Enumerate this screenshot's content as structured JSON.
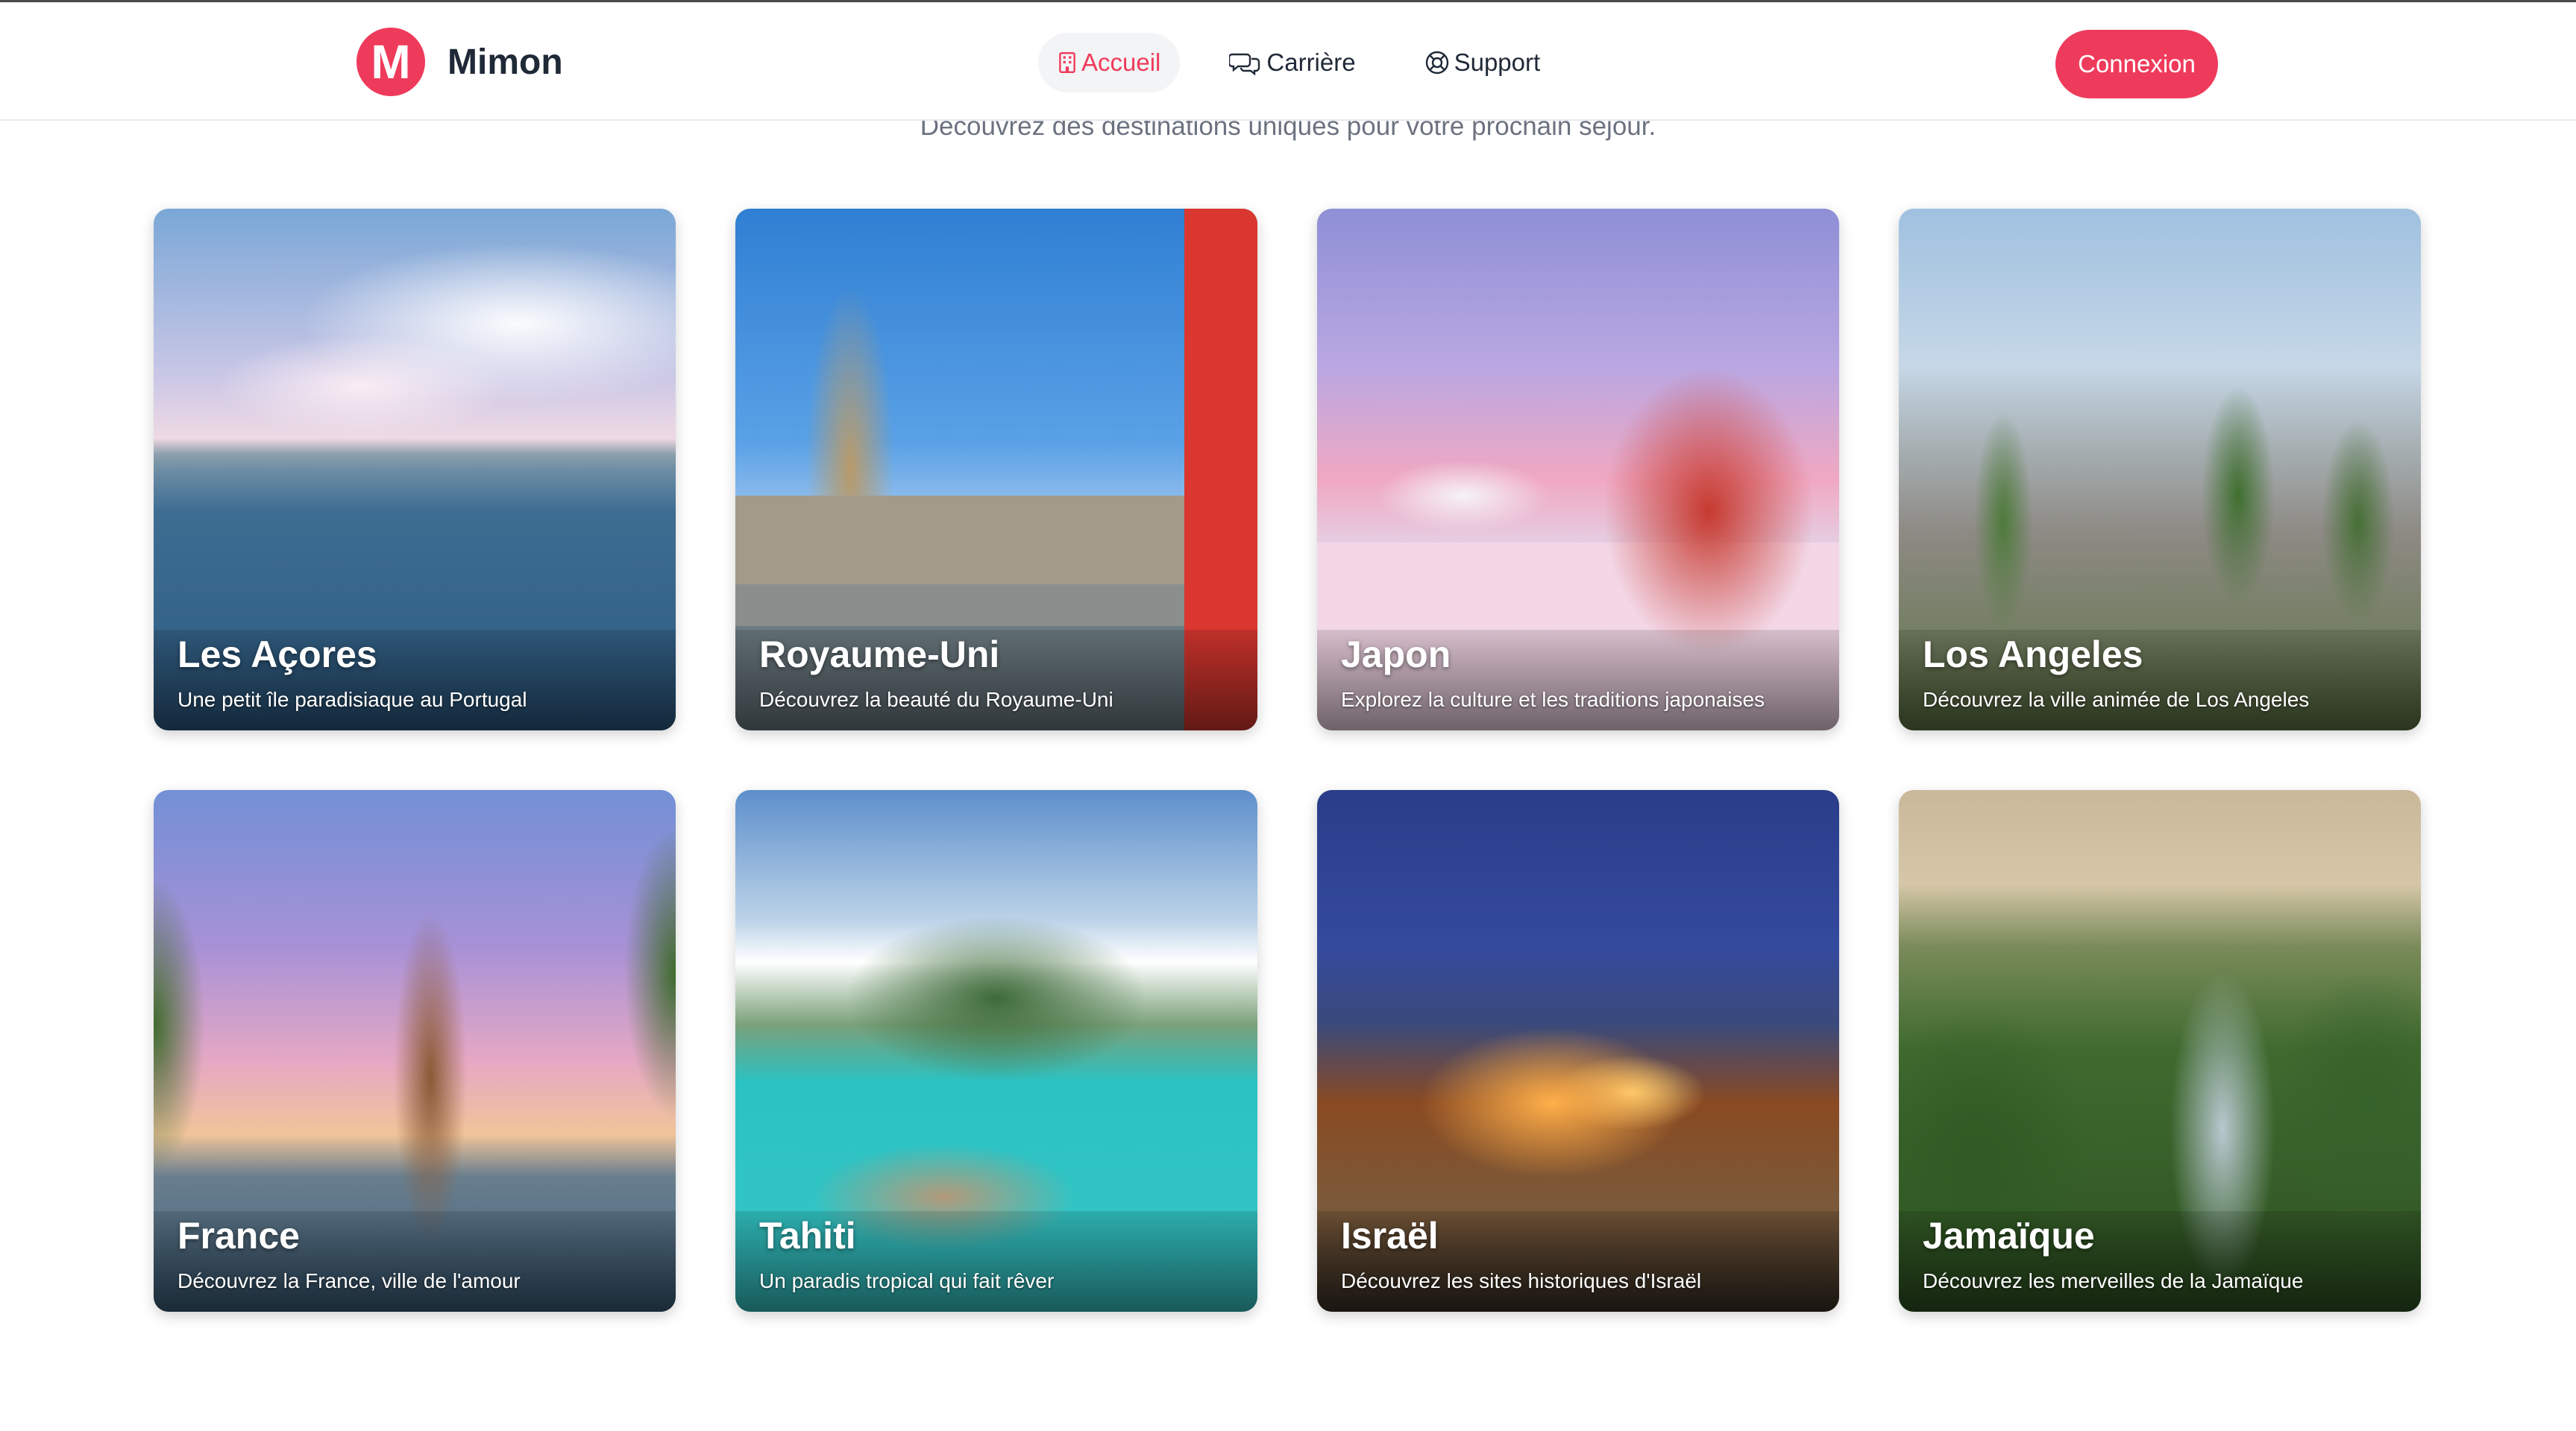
{
  "header": {
    "brand_name": "Mimon",
    "logo_letter": "M",
    "nav": [
      {
        "label": "Accueil",
        "icon": "building-icon",
        "active": true
      },
      {
        "label": "Carrière",
        "icon": "chat-bubbles-icon",
        "active": false
      },
      {
        "label": "Support",
        "icon": "lifebuoy-icon",
        "active": false
      }
    ],
    "login_label": "Connexion"
  },
  "subtitle": "Découvrez des destinations uniques pour votre prochain séjour.",
  "destinations": [
    {
      "title": "Les Açores",
      "description": "Une petit île paradisiaque au Portugal"
    },
    {
      "title": "Royaume-Uni",
      "description": "Découvrez la beauté du Royaume-Uni"
    },
    {
      "title": "Japon",
      "description": "Explorez la culture et les traditions japonaises"
    },
    {
      "title": "Los Angeles",
      "description": "Découvrez la ville animée de Los Angeles"
    },
    {
      "title": "France",
      "description": "Découvrez la France, ville de l'amour"
    },
    {
      "title": "Tahiti",
      "description": "Un paradis tropical qui fait rêver"
    },
    {
      "title": "Israël",
      "description": "Découvrez les sites historiques d'Israël"
    },
    {
      "title": "Jamaïque",
      "description": "Découvrez les merveilles de la Jamaïque"
    }
  ],
  "colors": {
    "accent": "#ef3b5b",
    "text": "#1f2937",
    "muted": "#6b7280",
    "nav_active_bg": "#f3f4f6"
  }
}
